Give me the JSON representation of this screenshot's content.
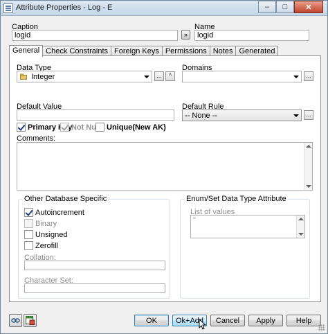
{
  "window": {
    "title": "Attribute Properties - Log - E",
    "minimize": "–",
    "maximize": "□",
    "close": "✕"
  },
  "caption": {
    "label": "Caption",
    "value": "logid"
  },
  "copy_button": {
    "label": "»"
  },
  "name": {
    "label": "Name",
    "value": "logid"
  },
  "tabs": [
    "General",
    "Check Constraints",
    "Foreign Keys",
    "Permissions",
    "Notes",
    "Generated"
  ],
  "active_tab": "General",
  "general": {
    "data_type": {
      "label": "Data Type",
      "value": "Integer",
      "more": "...",
      "up": "^"
    },
    "domains": {
      "label": "Domains",
      "value": "",
      "more": "..."
    },
    "default_value": {
      "label": "Default Value",
      "value": ""
    },
    "default_rule": {
      "label": "Default Rule",
      "value": "-- None --",
      "more": "..."
    },
    "primary_key": {
      "label": "Primary Key",
      "checked": true
    },
    "not_null": {
      "label": "Not Null",
      "checked": true
    },
    "unique": {
      "label": "Unique(New AK)",
      "checked": false
    },
    "comments": {
      "label": "Comments:",
      "value": ""
    },
    "db_specific": {
      "title": "Other Database Specific",
      "autoincrement": {
        "label": "Autoincrement",
        "checked": true
      },
      "binary": {
        "label": "Binary",
        "checked": false
      },
      "unsigned": {
        "label": "Unsigned",
        "checked": false
      },
      "zerofill": {
        "label": "Zerofill",
        "checked": false
      },
      "collation": {
        "label": "Collation:",
        "value": ""
      },
      "character_set": {
        "label": "Character Set:",
        "value": ""
      }
    },
    "enum_set": {
      "title": "Enum/Set Data Type Attribute",
      "list_label": "List of values",
      "list_first": "\""
    }
  },
  "buttons": {
    "ok": "OK",
    "ok_add": "Ok+Add",
    "cancel": "Cancel",
    "apply": "Apply",
    "help": "Help"
  },
  "colors": {
    "accent": "#3c7fb1",
    "title_bg": "#c4d6e8",
    "close": "#c4432b"
  }
}
